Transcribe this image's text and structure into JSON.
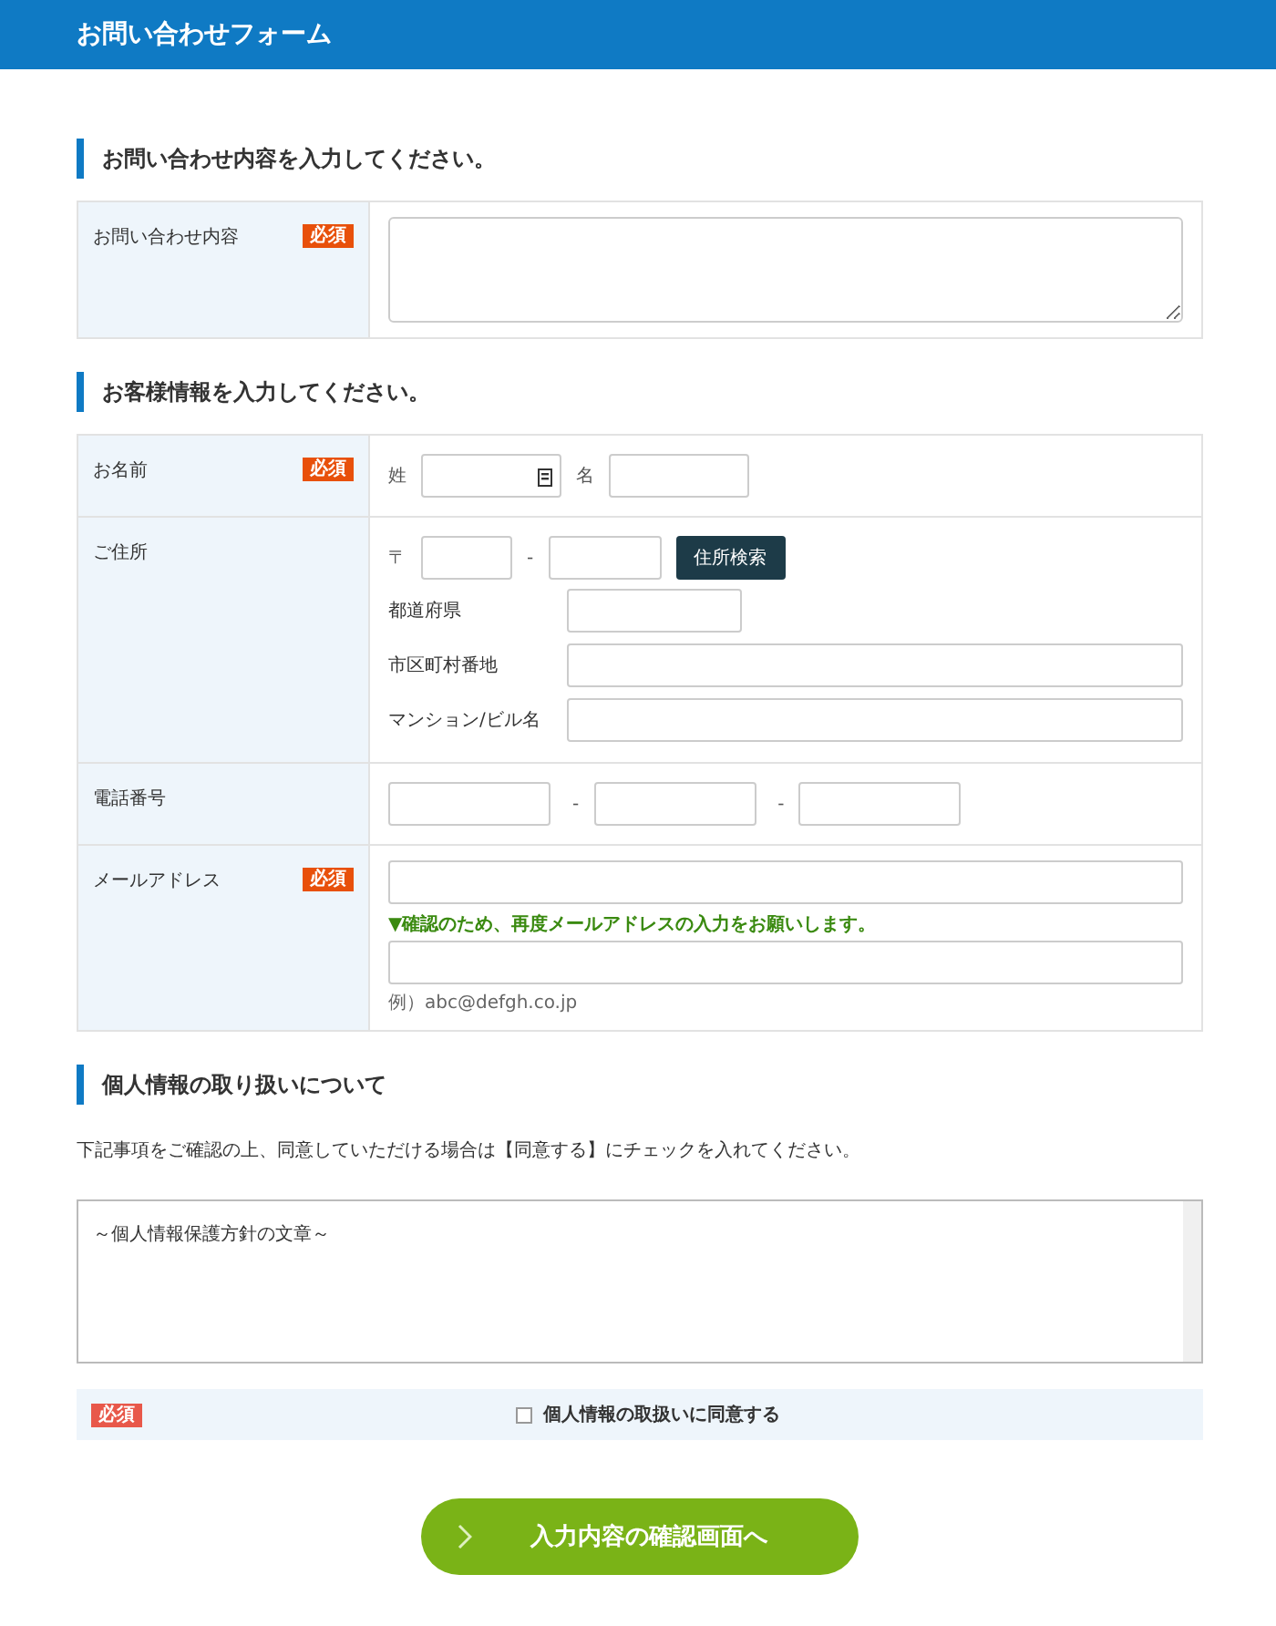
{
  "header": {
    "title": "お問い合わせフォーム"
  },
  "sections": [
    {
      "heading": "お問い合わせ内容を入力してください。",
      "rows": [
        {
          "kind": "textarea",
          "label": "お問い合わせ内容",
          "badge": "必須"
        }
      ]
    },
    {
      "heading": "お客様情報を入力してください。",
      "rows": [
        {
          "kind": "name",
          "label": "お名前",
          "badge": "必須",
          "fields": [
            {
              "label": "姓"
            },
            {
              "label": "名"
            }
          ]
        },
        {
          "kind": "address",
          "label": "ご住所",
          "postal_mark": "〒",
          "separator": "-",
          "button": "住所検索",
          "fields": [
            {
              "label": "都道府県"
            },
            {
              "label": "市区町村番地"
            },
            {
              "label": "マンション/ビル名"
            }
          ]
        },
        {
          "kind": "phone",
          "label": "電話番号",
          "separators": [
            "-",
            "-"
          ]
        },
        {
          "kind": "email",
          "label": "メールアドレス",
          "badge": "必須",
          "note": "▼確認のため、再度メールアドレスの入力をお願いします。",
          "example": "例）abc@defgh.co.jp"
        }
      ]
    }
  ],
  "privacy": {
    "heading": "個人情報の取り扱いについて",
    "instructions": "下記事項をご確認の上、同意していただける場合は【同意する】にチェックを入れてください。",
    "policy_text": "～個人情報保護方針の文章～",
    "agreement": {
      "badge": "必須",
      "label": "個人情報の取扱いに同意する",
      "checked": false
    }
  },
  "submit": {
    "label": "入力内容の確認画面へ"
  }
}
